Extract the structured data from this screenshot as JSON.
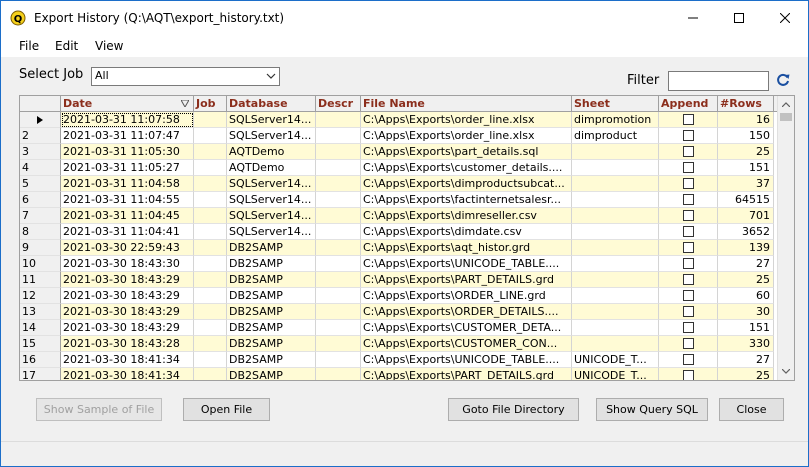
{
  "window": {
    "title": "Export History (Q:\\AQT\\export_history.txt)",
    "accent": "#1c6ec9"
  },
  "menu": [
    "File",
    "Edit",
    "View"
  ],
  "controls": {
    "select_job_label": "Select Job",
    "select_job_value": "All",
    "filter_label": "Filter",
    "filter_value": ""
  },
  "grid": {
    "columns": [
      "Date",
      "Job",
      "Database",
      "Descr",
      "File Name",
      "Sheet",
      "Append",
      "#Rows"
    ],
    "sort_column": "Date",
    "sort_order": "descending",
    "row_colors": [
      "#fffbd5",
      "#ffffff"
    ],
    "header_text_color": "#8b2e1c",
    "rows": [
      {
        "num": "",
        "date": "2021-03-31 11:07:58",
        "job": "",
        "database": "SQLServer14...",
        "descr": "",
        "file": "C:\\Apps\\Exports\\order_line.xlsx",
        "sheet": "dimpromotion",
        "append": false,
        "rows": "16"
      },
      {
        "num": "2",
        "date": "2021-03-31 11:07:47",
        "job": "",
        "database": "SQLServer14...",
        "descr": "",
        "file": "C:\\Apps\\Exports\\order_line.xlsx",
        "sheet": "dimproduct",
        "append": false,
        "rows": "150"
      },
      {
        "num": "3",
        "date": "2021-03-31 11:05:30",
        "job": "",
        "database": "AQTDemo",
        "descr": "",
        "file": "C:\\Apps\\Exports\\part_details.sql",
        "sheet": "",
        "append": false,
        "rows": "25"
      },
      {
        "num": "4",
        "date": "2021-03-31 11:05:27",
        "job": "",
        "database": "AQTDemo",
        "descr": "",
        "file": "C:\\Apps\\Exports\\customer_details....",
        "sheet": "",
        "append": false,
        "rows": "151"
      },
      {
        "num": "5",
        "date": "2021-03-31 11:04:58",
        "job": "",
        "database": "SQLServer14...",
        "descr": "",
        "file": "C:\\Apps\\Exports\\dimproductsubcat...",
        "sheet": "",
        "append": false,
        "rows": "37"
      },
      {
        "num": "6",
        "date": "2021-03-31 11:04:55",
        "job": "",
        "database": "SQLServer14...",
        "descr": "",
        "file": "C:\\Apps\\Exports\\factinternetsalesr...",
        "sheet": "",
        "append": false,
        "rows": "64515"
      },
      {
        "num": "7",
        "date": "2021-03-31 11:04:45",
        "job": "",
        "database": "SQLServer14...",
        "descr": "",
        "file": "C:\\Apps\\Exports\\dimreseller.csv",
        "sheet": "",
        "append": false,
        "rows": "701"
      },
      {
        "num": "8",
        "date": "2021-03-31 11:04:41",
        "job": "",
        "database": "SQLServer14...",
        "descr": "",
        "file": "C:\\Apps\\Exports\\dimdate.csv",
        "sheet": "",
        "append": false,
        "rows": "3652"
      },
      {
        "num": "9",
        "date": "2021-03-30 22:59:43",
        "job": "",
        "database": "DB2SAMP",
        "descr": "",
        "file": "C:\\Apps\\Exports\\aqt_histor.grd",
        "sheet": "",
        "append": false,
        "rows": "139"
      },
      {
        "num": "10",
        "date": "2021-03-30 18:43:30",
        "job": "",
        "database": "DB2SAMP",
        "descr": "",
        "file": "C:\\Apps\\Exports\\UNICODE_TABLE....",
        "sheet": "",
        "append": false,
        "rows": "27"
      },
      {
        "num": "11",
        "date": "2021-03-30 18:43:29",
        "job": "",
        "database": "DB2SAMP",
        "descr": "",
        "file": "C:\\Apps\\Exports\\PART_DETAILS.grd",
        "sheet": "",
        "append": false,
        "rows": "25"
      },
      {
        "num": "12",
        "date": "2021-03-30 18:43:29",
        "job": "",
        "database": "DB2SAMP",
        "descr": "",
        "file": "C:\\Apps\\Exports\\ORDER_LINE.grd",
        "sheet": "",
        "append": false,
        "rows": "60"
      },
      {
        "num": "13",
        "date": "2021-03-30 18:43:29",
        "job": "",
        "database": "DB2SAMP",
        "descr": "",
        "file": "C:\\Apps\\Exports\\ORDER_DETAILS....",
        "sheet": "",
        "append": false,
        "rows": "30"
      },
      {
        "num": "14",
        "date": "2021-03-30 18:43:29",
        "job": "",
        "database": "DB2SAMP",
        "descr": "",
        "file": "C:\\Apps\\Exports\\CUSTOMER_DETA...",
        "sheet": "",
        "append": false,
        "rows": "151"
      },
      {
        "num": "15",
        "date": "2021-03-30 18:43:28",
        "job": "",
        "database": "DB2SAMP",
        "descr": "",
        "file": "C:\\Apps\\Exports\\CUSTOMER_CON...",
        "sheet": "",
        "append": false,
        "rows": "330"
      },
      {
        "num": "16",
        "date": "2021-03-30 18:41:34",
        "job": "",
        "database": "DB2SAMP",
        "descr": "",
        "file": "C:\\Apps\\Exports\\UNICODE_TABLE....",
        "sheet": "UNICODE_T...",
        "append": false,
        "rows": "27"
      },
      {
        "num": "17",
        "date": "2021-03-30 18:41:34",
        "job": "",
        "database": "DB2SAMP",
        "descr": "",
        "file": "C:\\Apps\\Exports\\PART_DETAILS.grd",
        "sheet": "UNICODE_T...",
        "append": false,
        "rows": "25"
      }
    ]
  },
  "buttons": {
    "show_sample": "Show Sample of File",
    "open_file": "Open File",
    "goto_dir": "Goto File Directory",
    "show_query": "Show Query SQL",
    "close": "Close"
  }
}
